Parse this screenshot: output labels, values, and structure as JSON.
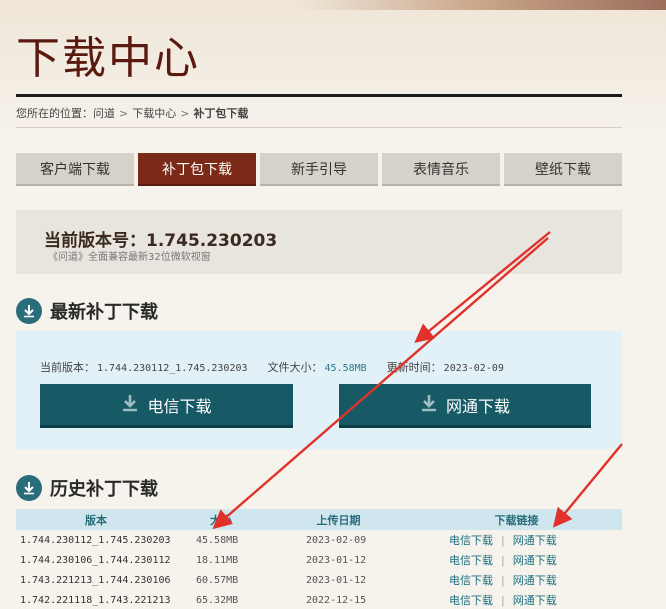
{
  "page": {
    "title": "下载中心"
  },
  "breadcrumb": {
    "prefix": "您所在的位置：",
    "items": [
      "问道",
      "下载中心",
      "补丁包下载"
    ],
    "separator": ">"
  },
  "tabs": [
    {
      "label": "客户端下载",
      "active": false
    },
    {
      "label": "补丁包下载",
      "active": true
    },
    {
      "label": "新手引导",
      "active": false
    },
    {
      "label": "表情音乐",
      "active": false
    },
    {
      "label": "壁纸下载",
      "active": false
    }
  ],
  "version": {
    "label": "当前版本号：1.745.230203",
    "sub": "《问道》全面兼容最新32位微软视窗"
  },
  "latest": {
    "heading": "最新补丁下载",
    "version_key": "当前版本：",
    "version_value": "1.744.230112_1.745.230203",
    "size_key": "文件大小：",
    "size_value": "45.58MB",
    "time_key": "更新时间：",
    "time_value": "2023-02-09",
    "btn_telecom": "电信下载",
    "btn_netcom": "网通下载"
  },
  "history": {
    "heading": "历史补丁下载",
    "columns": [
      "版本",
      "大小",
      "上传日期",
      "下载链接"
    ],
    "link_telecom": "电信下载",
    "link_netcom": "网通下载",
    "link_sep": "|",
    "rows": [
      {
        "version": "1.744.230112_1.745.230203",
        "size": "45.58MB",
        "date": "2023-02-09"
      },
      {
        "version": "1.744.230106_1.744.230112",
        "size": "18.11MB",
        "date": "2023-01-12"
      },
      {
        "version": "1.743.221213_1.744.230106",
        "size": "60.57MB",
        "date": "2023-01-12"
      },
      {
        "version": "1.742.221118_1.743.221213",
        "size": "65.32MB",
        "date": "2022-12-15"
      }
    ]
  },
  "colors": {
    "brand": "#7a2a17",
    "button": "#175a66",
    "annotation_arrow": "#e0322a"
  },
  "icons": [
    "download-circle-icon",
    "download-arrow-icon"
  ]
}
